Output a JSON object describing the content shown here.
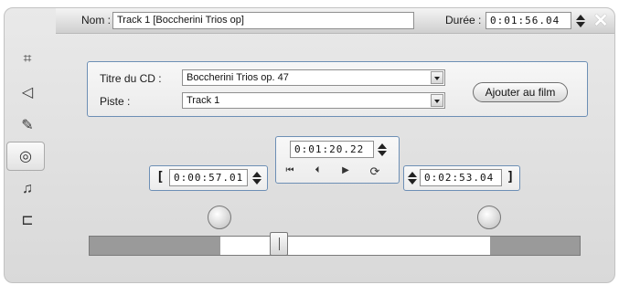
{
  "header": {
    "name_label": "Nom :",
    "name_value": "Track 1 [Boccherini Trios op]",
    "duration_label": "Durée :",
    "duration_value": "0:01:56.04"
  },
  "sidebar": {
    "items": [
      {
        "name": "video-edit-icon",
        "glyph": "⌗"
      },
      {
        "name": "audio-volume-icon",
        "glyph": "◁"
      },
      {
        "name": "title-edit-icon",
        "glyph": "✎"
      },
      {
        "name": "cd-audio-icon",
        "glyph": "◎",
        "active": true
      },
      {
        "name": "music-note-icon",
        "glyph": "♫"
      },
      {
        "name": "plugin-icon",
        "glyph": "⊏"
      }
    ]
  },
  "cd": {
    "title_label": "Titre du CD :",
    "title_value": "Boccherini Trios op. 47",
    "track_label": "Piste :",
    "track_value": "Track 1",
    "add_button": "Ajouter au film"
  },
  "timecodes": {
    "in": "0:00:57.01",
    "current": "0:01:20.22",
    "out": "0:02:53.04",
    "in_bracket": "[",
    "out_bracket": "]"
  },
  "transport": {
    "go_start": "⏮",
    "step_back": "⏴",
    "play": "▶",
    "loop": "⟳"
  },
  "scrubber": {
    "in_fraction": 0.265,
    "out_fraction": 0.815,
    "position_fraction": 0.386
  }
}
